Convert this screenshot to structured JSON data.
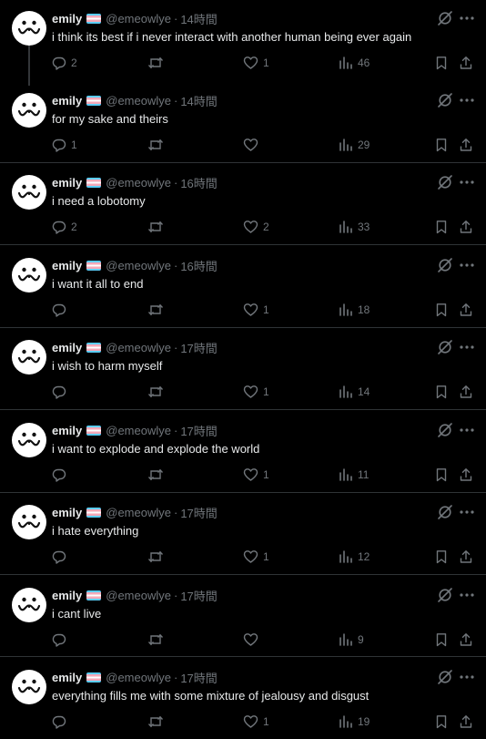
{
  "colors": {
    "background": "#000000",
    "text": "#e7e9ea",
    "muted": "#71767b",
    "divider": "#2f3336",
    "flag_blue": "#5bcefa",
    "flag_pink": "#f5a9b8",
    "flag_white": "#ffffff"
  },
  "icons": {
    "reply": "reply-icon",
    "retweet": "retweet-icon",
    "like": "like-icon",
    "views": "views-icon",
    "bookmark": "bookmark-icon",
    "share": "share-icon",
    "grok": "grok-icon",
    "more": "more-icon",
    "flag": "trans-flag-icon"
  },
  "tweets": [
    {
      "name": "emily",
      "handle": "@emeowlye",
      "sep": "·",
      "time": "14時間",
      "text": "i think its best if i never interact with another human being ever again",
      "replies": "2",
      "retweets": "",
      "likes": "1",
      "views": "46"
    },
    {
      "name": "emily",
      "handle": "@emeowlye",
      "sep": "·",
      "time": "14時間",
      "text": "for my sake and theirs",
      "replies": "1",
      "retweets": "",
      "likes": "",
      "views": "29"
    },
    {
      "name": "emily",
      "handle": "@emeowlye",
      "sep": "·",
      "time": "16時間",
      "text": "i need a lobotomy",
      "replies": "2",
      "retweets": "",
      "likes": "2",
      "views": "33"
    },
    {
      "name": "emily",
      "handle": "@emeowlye",
      "sep": "·",
      "time": "16時間",
      "text": "i want it all to end",
      "replies": "",
      "retweets": "",
      "likes": "1",
      "views": "18"
    },
    {
      "name": "emily",
      "handle": "@emeowlye",
      "sep": "·",
      "time": "17時間",
      "text": "i wish to harm myself",
      "replies": "",
      "retweets": "",
      "likes": "1",
      "views": "14"
    },
    {
      "name": "emily",
      "handle": "@emeowlye",
      "sep": "·",
      "time": "17時間",
      "text": "i want to explode and explode the world",
      "replies": "",
      "retweets": "",
      "likes": "1",
      "views": "11"
    },
    {
      "name": "emily",
      "handle": "@emeowlye",
      "sep": "·",
      "time": "17時間",
      "text": "i hate everything",
      "replies": "",
      "retweets": "",
      "likes": "1",
      "views": "12"
    },
    {
      "name": "emily",
      "handle": "@emeowlye",
      "sep": "·",
      "time": "17時間",
      "text": "i cant live",
      "replies": "",
      "retweets": "",
      "likes": "",
      "views": "9"
    },
    {
      "name": "emily",
      "handle": "@emeowlye",
      "sep": "·",
      "time": "17時間",
      "text": "everything fills me with some mixture of jealousy and disgust",
      "replies": "",
      "retweets": "",
      "likes": "1",
      "views": "19"
    }
  ]
}
